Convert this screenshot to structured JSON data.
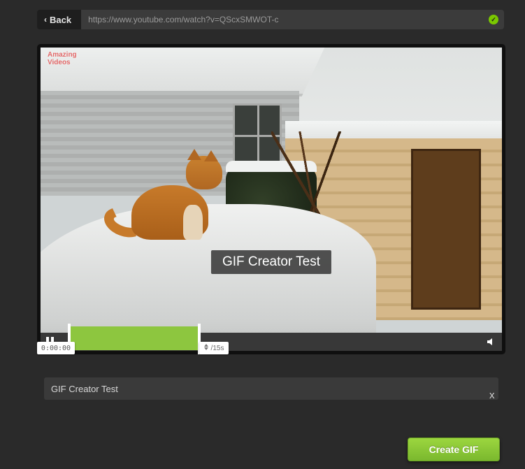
{
  "topbar": {
    "back_label": "Back",
    "url": "https://www.youtube.com/watch?v=QScxSMWOT-c"
  },
  "video": {
    "watermark_line1": "Amazing",
    "watermark_line2": "Videos",
    "overlay_caption": "GIF Creator Test"
  },
  "timeline": {
    "start_time": "0:00:00",
    "duration_label": "/15s"
  },
  "caption": {
    "value": "GIF Creator Test"
  },
  "buttons": {
    "close": "x",
    "create": "Create GIF"
  }
}
